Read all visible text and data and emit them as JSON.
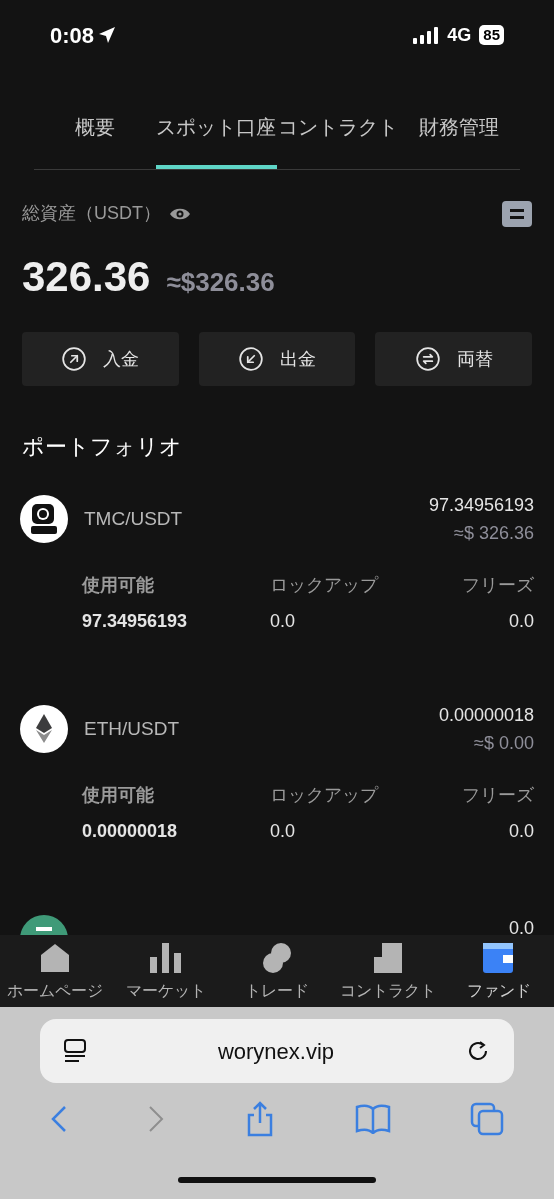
{
  "status_bar": {
    "time": "0:08",
    "network": "4G",
    "battery": "85"
  },
  "tabs": [
    {
      "label": "概要",
      "selected": false
    },
    {
      "label": "スポット口座",
      "selected": true
    },
    {
      "label": "コントラクト",
      "selected": false
    },
    {
      "label": "財務管理",
      "selected": false
    }
  ],
  "total": {
    "label": "総資産（USDT）",
    "amount": "326.36",
    "approx": "≈$326.36"
  },
  "actions": [
    {
      "kind": "deposit",
      "label": "入金"
    },
    {
      "kind": "withdraw",
      "label": "出金"
    },
    {
      "kind": "exchange",
      "label": "両替"
    }
  ],
  "portfolio_title": "ポートフォリオ",
  "assets": [
    {
      "kind": "tmc",
      "pair": "TMC/USDT",
      "amount": "97.34956193",
      "value": "≈$ 326.36",
      "available_label": "使用可能",
      "available": "97.34956193",
      "locked_label": "ロックアップ",
      "locked": "0.0",
      "frozen_label": "フリーズ",
      "frozen": "0.0"
    },
    {
      "kind": "eth",
      "pair": "ETH/USDT",
      "amount": "0.00000018",
      "value": "≈$ 0.00",
      "available_label": "使用可能",
      "available": "0.00000018",
      "locked_label": "ロックアップ",
      "locked": "0.0",
      "frozen_label": "フリーズ",
      "frozen": "0.0"
    }
  ],
  "clipped_row": {
    "amount": "0.0"
  },
  "bottom_nav": [
    {
      "kind": "home",
      "label": "ホームページ",
      "selected": false
    },
    {
      "kind": "market",
      "label": "マーケット",
      "selected": false
    },
    {
      "kind": "trade",
      "label": "トレード",
      "selected": false
    },
    {
      "kind": "contract",
      "label": "コントラクト",
      "selected": false
    },
    {
      "kind": "fund",
      "label": "ファンド",
      "selected": true
    }
  ],
  "browser": {
    "url": "worynex.vip"
  }
}
